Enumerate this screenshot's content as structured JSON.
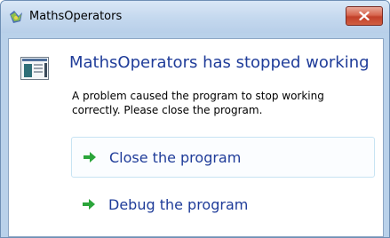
{
  "window": {
    "title": "MathsOperators",
    "close_icon": "close-icon"
  },
  "dialog": {
    "heading": "MathsOperators has stopped working",
    "message": "A problem caused the program to stop working correctly. Please close the program.",
    "options": [
      {
        "label": "Close the program",
        "icon": "green-arrow-icon",
        "selected": true
      },
      {
        "label": "Debug the program",
        "icon": "green-arrow-icon",
        "selected": false
      }
    ]
  },
  "colors": {
    "heading": "#1f3c99",
    "option_text": "#1f3c99",
    "arrow": "#2ba53a",
    "close_button": "#c2402a"
  }
}
